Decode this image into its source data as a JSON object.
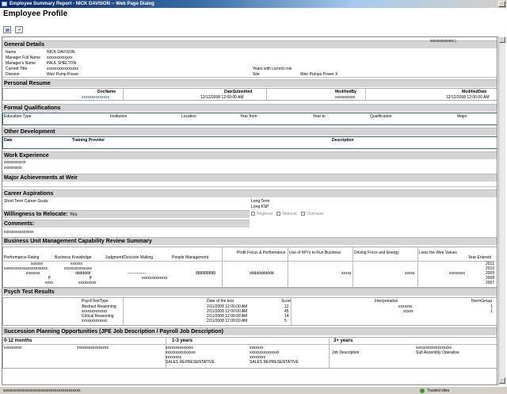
{
  "window": {
    "title": "Employee Summary Report - NICK DAVISON -- Web Page Dialog"
  },
  "page": {
    "title": "Employee Profile"
  },
  "general": {
    "heading": "General Details",
    "top_right": "xxxxxxxxxxxx |",
    "fields": [
      {
        "label": "Name",
        "value": "NICK DAVISON"
      },
      {
        "label": "Manager Full Name",
        "value": "xxxxxxxxxxxxx"
      },
      {
        "label": "Manager's Name",
        "value": "PAUL SHELTON"
      },
      {
        "label": "Current Title",
        "value": "xxxxxxxxxxxxxxxx"
      },
      {
        "label": "Division",
        "value": "Weir Pump Power"
      }
    ],
    "right_fields": [
      {
        "label": "Years with current role",
        "value": ""
      },
      {
        "label": "Site",
        "value": "Weir Pumps",
        "extra": "Weir Pumps Power X"
      }
    ]
  },
  "resume": {
    "heading": "Personal Resume",
    "columns": [
      "DocName",
      "DateSubmitted",
      "ModifiedBy",
      "ModifiedDate"
    ],
    "rows": [
      [
        "xxxxxxxxxxxxxx",
        "12/12/2008 12:00:00 AM",
        "xxxxxxxxxx",
        "12/12/2008 12:00:00 AM"
      ]
    ]
  },
  "qualifications": {
    "heading": "Formal Qualifications",
    "columns": [
      "Education Type",
      "Institution",
      "Location",
      "Year from",
      "Year to",
      "Qualification",
      "Major"
    ]
  },
  "development": {
    "heading": "Other Development",
    "columns": [
      "Date",
      "Training Provider",
      "Description"
    ]
  },
  "experience": {
    "heading": "Work Experience",
    "lines": [
      "xxxxxxxxxxx",
      "xxxxxxxxx"
    ]
  },
  "achievements": {
    "heading": "Major Achievements at Weir"
  },
  "aspirations": {
    "heading": "Career Aspirations",
    "short_term": "Short Term Career Goals",
    "long_term": "Long Term",
    "long_term_value": "Long KSP"
  },
  "relocate": {
    "heading": "Willingness to Relocate:",
    "value": "Yes",
    "options": [
      "Regional",
      "National",
      "Overseas"
    ]
  },
  "comments": {
    "heading": "Comments:",
    "value": "xxxxxxxxxxxxxxx"
  },
  "capability": {
    "heading": "Business Unit Management Capability Review Summary",
    "columns": [
      "Performance Rating",
      "Business Knowledge",
      "Judgment/Decision Making",
      "People Management",
      "Profit Focus & Performance",
      "Use of KPI's to Run Business",
      "Driving Force and Energy",
      "Lives the Weir Values",
      "Year Entered"
    ],
    "rows": [
      [
        "xxxxxx",
        "xxxxxx",
        "",
        "",
        "",
        "",
        "",
        "",
        "2011"
      ],
      [
        "xxxxxxxxxxxxxxxxxxxxxx",
        "xxxxxxxxxxxxxx",
        "",
        "",
        "",
        "",
        "",
        "",
        "2010"
      ],
      [
        "xxxxxxx",
        "ddddddd",
        "--------------",
        "888888888",
        "ddddddddddd",
        "xxxxx",
        "xxxxx",
        "xxxxxxxx",
        "2009"
      ],
      [
        "ff",
        "ff",
        "xxxxxxxxxxxxx",
        "",
        "",
        "",
        "",
        "",
        "2008"
      ],
      [
        "xxxx",
        "xxxxxxxxx",
        "",
        "",
        "",
        "",
        "",
        "",
        "2007"
      ]
    ]
  },
  "psych": {
    "heading": "Psych Test Results",
    "columns": [
      "PsychTestType",
      "Date of the test",
      "Score",
      "Interpretation",
      "NormGroup"
    ],
    "rows": [
      [
        "Abstract Reasoning",
        "2/11/2008 12:00:00 AM",
        "12",
        "xxxxxxx",
        "1"
      ],
      [
        "xxxxxxxxxxxxx",
        "2/11/2008 12:00:00 AM",
        "45",
        "xxxxx",
        "1"
      ],
      [
        "Critical Reasoning",
        "2/11/2008 12:00:00 AM",
        "14",
        "",
        ""
      ],
      [
        "xxxxxxxxxxxxx",
        "2/11/2008 12:00:00 AM",
        "5",
        "",
        ""
      ]
    ]
  },
  "succession": {
    "heading": "Succession Planning Opportunities (JPE Job Description / Payroll Job Description)",
    "col1": "0-12 months",
    "col2": "1-3 years",
    "col3": "3+ years",
    "col1_value": "xxxxxxxxx",
    "col1_value2": "xxxxxxxxxxxxxxxx",
    "col2_lines": [
      "xxxxxxxxxxxxxx",
      "xxxxxxxxxxxxxxx",
      "xxxxxxxx",
      "SALES REPRESENTATIVE"
    ],
    "col2b_lines": [
      "xxxxxxx",
      "xxxxxxxxxxxxxxx",
      "xxxxxxxx",
      "SALES REPRESENTATIVE"
    ],
    "col3_lines": [
      "xxxxxxxxxxxxxxxxxx",
      "Sub Assembly Operative"
    ],
    "col3_label": "Job Description"
  },
  "status": {
    "left": "xxxxxxxxxxxxxxxxxxxxxxxxxxxxxxxxxxxxxxx",
    "right": "Trusted sites"
  }
}
